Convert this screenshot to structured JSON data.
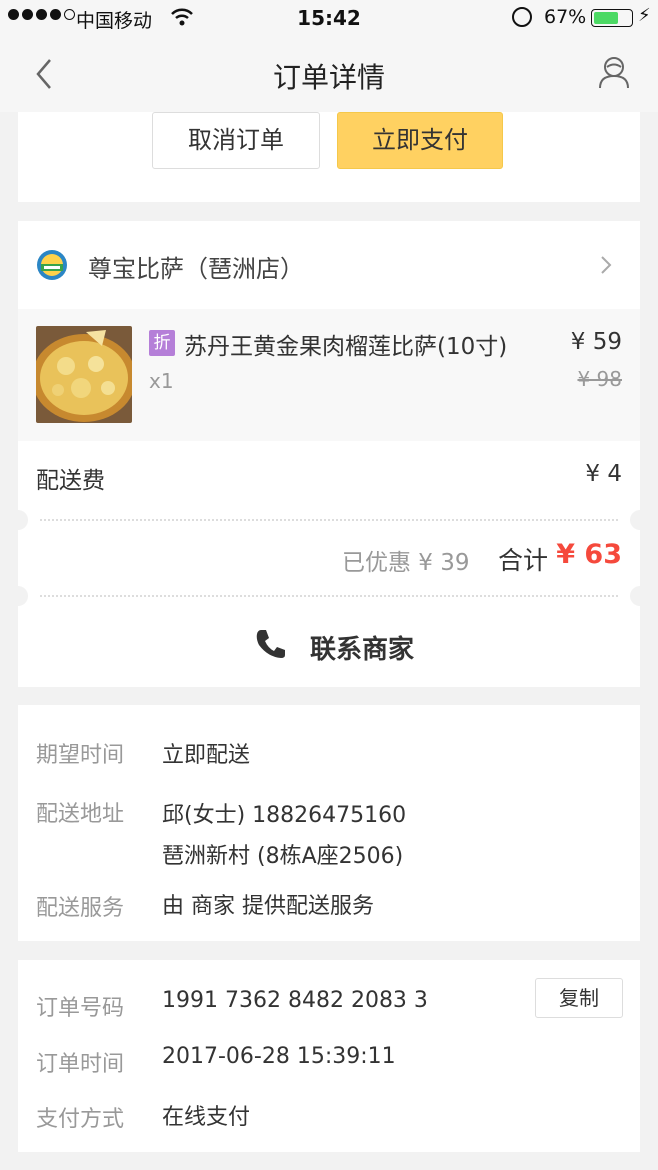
{
  "status_bar": {
    "carrier": "中国移动",
    "time": "15:42",
    "battery": "67%",
    "battery_level": 0.67
  },
  "nav": {
    "title": "订单详情"
  },
  "actions": {
    "cancel": "取消订单",
    "pay": "立即支付"
  },
  "shop": {
    "name": "尊宝比萨（琶洲店）",
    "item": {
      "badge": "折",
      "name": "苏丹王黄金果肉榴莲比萨(10寸)",
      "qty": "x1",
      "price": "¥ 59",
      "original_price": "¥ 98"
    },
    "delivery_fee_label": "配送费",
    "delivery_fee": "¥ 4",
    "discount": "已优惠 ¥ 39",
    "total_label": "合计",
    "total": "¥ 63",
    "contact": "联系商家"
  },
  "delivery": {
    "time_label": "期望时间",
    "time_value": "立即配送",
    "address_label": "配送地址",
    "address_contact": "邱(女士) 18826475160",
    "address_detail": "琶洲新村 (8栋A座2506)",
    "service_label": "配送服务",
    "service_value": "由 商家 提供配送服务"
  },
  "order": {
    "number_label": "订单号码",
    "number_value": "1991 7362 8482 2083 3",
    "copy": "复制",
    "time_label": "订单时间",
    "time_value": "2017-06-28 15:39:11",
    "payment_label": "支付方式",
    "payment_value": "在线支付"
  },
  "colors": {
    "accent": "#ffd161",
    "total": "#f5493c",
    "badge": "#b57fd8",
    "battery": "#4cd964"
  }
}
